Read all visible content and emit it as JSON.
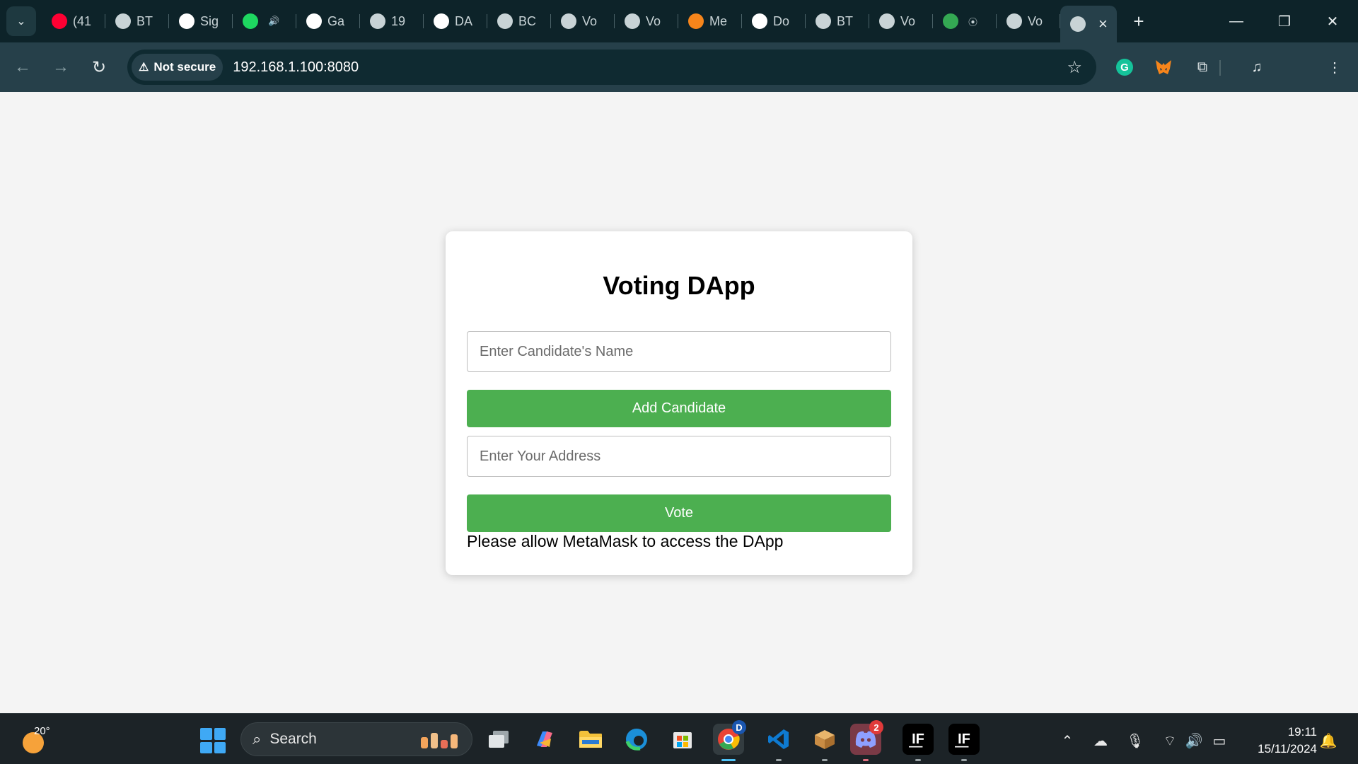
{
  "browser": {
    "tabs": [
      {
        "label": "(41",
        "favicon": "youtube-icon",
        "color": "#ff0033",
        "sub": ""
      },
      {
        "label": "BT",
        "favicon": "globe-icon",
        "color": "#c8d3d6",
        "sub": ""
      },
      {
        "label": "Sig",
        "favicon": "google-icon",
        "color": "#ffffff",
        "sub": ""
      },
      {
        "label": "",
        "favicon": "spotify-icon",
        "color": "#1ed760",
        "sub": "🔊"
      },
      {
        "label": "Ga",
        "favicon": "galaxy-icon",
        "color": "#ffffff",
        "sub": ""
      },
      {
        "label": "19",
        "favicon": "globe-icon",
        "color": "#c8d3d6",
        "sub": ""
      },
      {
        "label": "DA",
        "favicon": "openai-icon",
        "color": "#ffffff",
        "sub": ""
      },
      {
        "label": "BC",
        "favicon": "globe-icon",
        "color": "#c8d3d6",
        "sub": ""
      },
      {
        "label": "Vo",
        "favicon": "globe-icon",
        "color": "#c8d3d6",
        "sub": ""
      },
      {
        "label": "Vo",
        "favicon": "globe-icon",
        "color": "#c8d3d6",
        "sub": ""
      },
      {
        "label": "Me",
        "favicon": "metamask-icon",
        "color": "#f6851b",
        "sub": ""
      },
      {
        "label": "Do",
        "favicon": "download-icon",
        "color": "#ffffff",
        "sub": ""
      },
      {
        "label": "BT",
        "favicon": "globe-icon",
        "color": "#c8d3d6",
        "sub": ""
      },
      {
        "label": "Vo",
        "favicon": "globe-icon",
        "color": "#c8d3d6",
        "sub": ""
      },
      {
        "label": "",
        "favicon": "meet-icon",
        "color": "#34a853",
        "sub": "⦿"
      },
      {
        "label": "Vo",
        "favicon": "globe-icon",
        "color": "#c8d3d6",
        "sub": ""
      }
    ],
    "security_label": "Not secure",
    "url": "192.168.1.100:8080",
    "profile_initial": "D",
    "accent": "#26404a"
  },
  "app": {
    "title": "Voting DApp",
    "candidate_input": {
      "placeholder": "Enter Candidate's Name",
      "value": ""
    },
    "add_button_label": "Add Candidate",
    "address_input": {
      "placeholder": "Enter Your Address",
      "value": ""
    },
    "vote_button_label": "Vote",
    "status_message": "Please allow MetaMask to access the DApp",
    "button_color": "#4caf50"
  },
  "taskbar": {
    "weather_temp": "20°",
    "search_label": "Search",
    "discord_badge": "2",
    "profile_badge": "D",
    "time": "19:11",
    "date": "15/11/2024"
  }
}
